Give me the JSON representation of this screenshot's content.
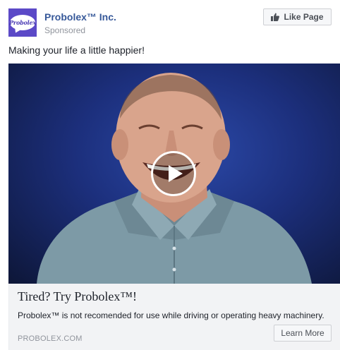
{
  "header": {
    "logo_text": "Probolex",
    "page_name": "Probolex™ Inc.",
    "sponsored": "Sponsored",
    "like_button_label": "Like Page"
  },
  "post": {
    "text": "Making your life a little happier!"
  },
  "media": {
    "type": "video",
    "play_icon": "play-icon"
  },
  "caption": {
    "headline": "Tired? Try Probolex™!",
    "description": "Probolex™ is not recomended for use while driving or operating heavy machinery.",
    "domain": "PROBOLEX.COM",
    "cta_label": "Learn More"
  },
  "colors": {
    "brand_purple": "#5b49c7",
    "link_blue": "#365899",
    "muted_gray": "#90949c"
  }
}
